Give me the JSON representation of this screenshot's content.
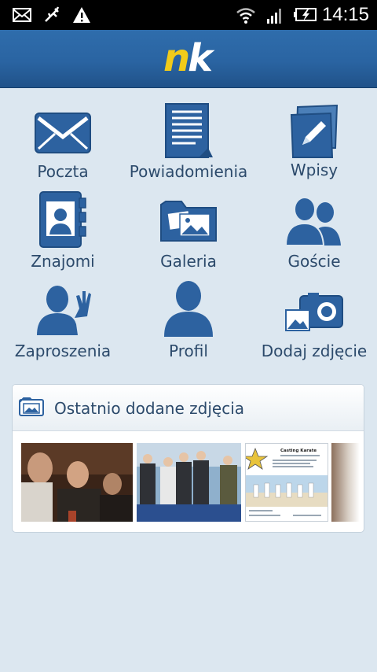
{
  "status_bar": {
    "time": "14:15",
    "icons": [
      "mail-icon",
      "usb-icon",
      "warning-icon",
      "wifi-icon",
      "signal-icon",
      "battery-charging-icon"
    ]
  },
  "header": {
    "logo_n": "n",
    "logo_k": "k"
  },
  "menu": {
    "poczta": "Poczta",
    "powiadomienia": "Powiadomienia",
    "wpisy": "Wpisy",
    "znajomi": "Znajomi",
    "galeria": "Galeria",
    "goscie": "Goście",
    "zaproszenia": "Zaproszenia",
    "profil": "Profil",
    "dodaj_zdjecie": "Dodaj zdjęcie"
  },
  "recent_photos": {
    "title": "Ostatnio dodane zdjęcia",
    "poster_title": "Casting Karate"
  },
  "colors": {
    "icon": "#2d62a0",
    "text": "#2c4a6b",
    "header": "#2a64a2",
    "background": "#dce7f0"
  }
}
